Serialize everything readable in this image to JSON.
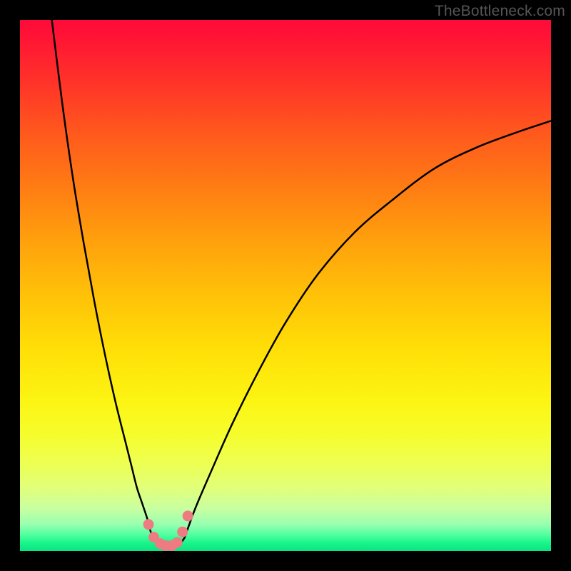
{
  "watermark": "TheBottleneck.com",
  "colors": {
    "background_frame": "#000000",
    "dot": "#ee7b82",
    "curve": "#000000"
  },
  "chart_data": {
    "type": "line",
    "title": "",
    "xlabel": "",
    "ylabel": "",
    "xlim": [
      0,
      100
    ],
    "ylim": [
      0,
      100
    ],
    "series": [
      {
        "name": "left-curve",
        "x": [
          6,
          8,
          10,
          12,
          14,
          16,
          18,
          20,
          21,
          22,
          23,
          24,
          24.5,
          25
        ],
        "y": [
          100,
          84,
          70,
          58,
          47,
          37,
          28,
          20,
          16,
          12,
          9,
          6,
          4,
          2.5
        ]
      },
      {
        "name": "right-curve",
        "x": [
          31,
          33,
          36,
          40,
          45,
          50,
          56,
          63,
          70,
          78,
          86,
          94,
          100
        ],
        "y": [
          2.5,
          8,
          15,
          24,
          34,
          43,
          52,
          60,
          66,
          72,
          76,
          79,
          81
        ]
      },
      {
        "name": "valley-floor",
        "x": [
          25,
          26,
          27,
          28,
          29,
          30,
          31
        ],
        "y": [
          2.5,
          1.2,
          0.8,
          0.7,
          0.8,
          1.2,
          2.5
        ]
      }
    ],
    "dots": {
      "x": [
        24.2,
        25.2,
        26.4,
        27.5,
        28.6,
        29.6,
        30.6,
        31.6
      ],
      "y": [
        5.0,
        2.6,
        1.4,
        1.0,
        1.0,
        1.6,
        3.6,
        6.6
      ]
    }
  }
}
